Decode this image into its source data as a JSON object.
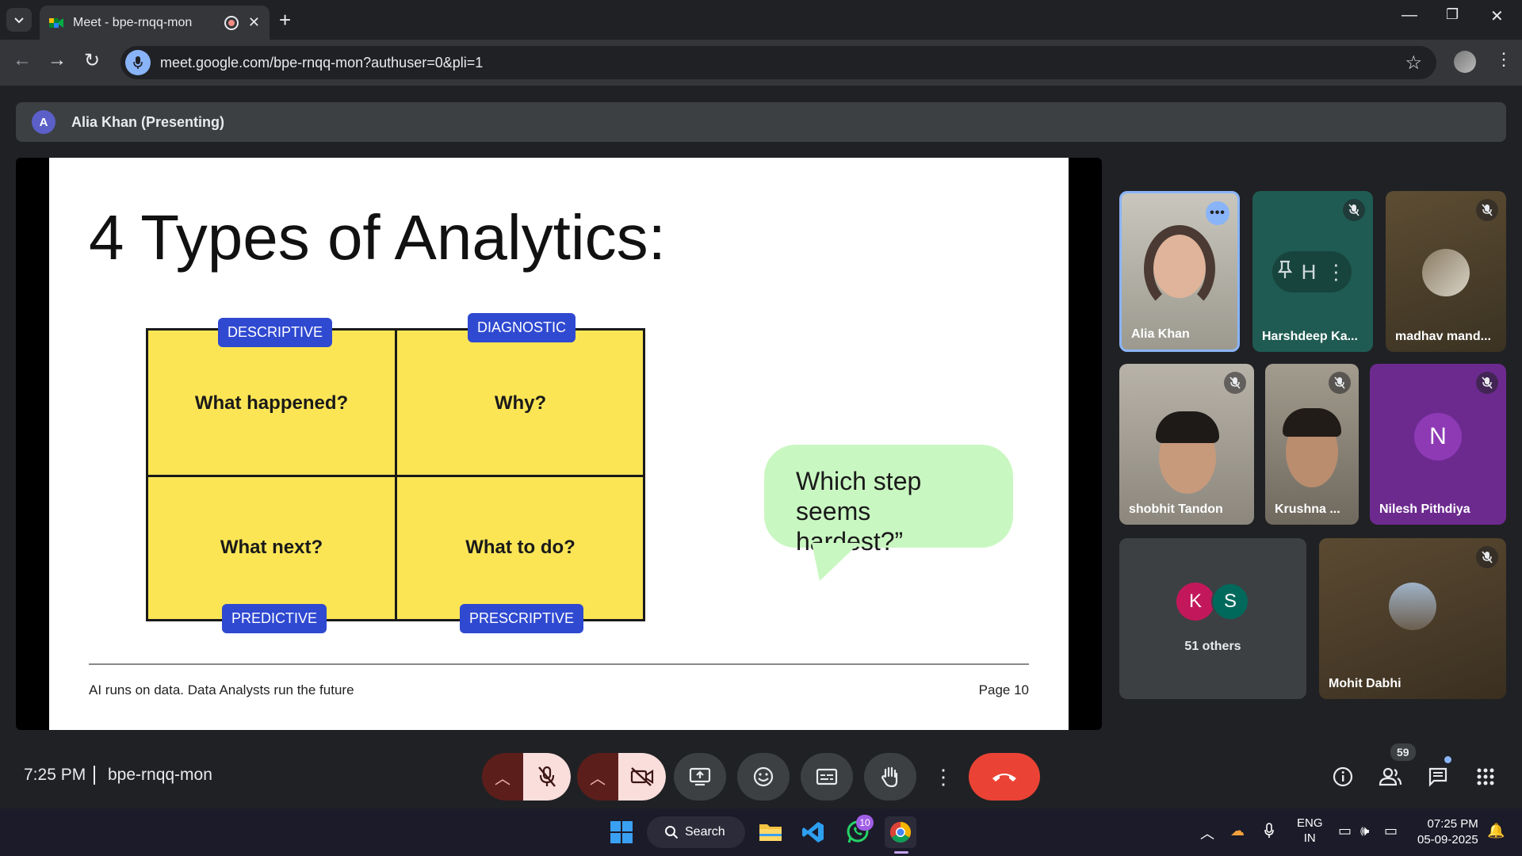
{
  "browser": {
    "tab_title": "Meet - bpe-rnqq-mon",
    "url": "meet.google.com/bpe-rnqq-mon?authuser=0&pli=1"
  },
  "presenting": {
    "avatar_letter": "A",
    "label": "Alia Khan (Presenting)"
  },
  "slide": {
    "title": "4 Types of Analytics:",
    "quadrants": {
      "top_left": {
        "tag": "DESCRIPTIVE",
        "text": "What happened?"
      },
      "top_right": {
        "tag": "DIAGNOSTIC",
        "text": "Why?"
      },
      "bottom_left": {
        "tag": "PREDICTIVE",
        "text": "What next?"
      },
      "bottom_right": {
        "tag": "PRESCRIPTIVE",
        "text": "What to do?"
      }
    },
    "bubble_line1": "Which step",
    "bubble_line2": "seems hardest?”",
    "footer": "AI runs on data. Data Analysts run the future",
    "page": "Page 10"
  },
  "participants": {
    "p1": {
      "name": "Alia Khan"
    },
    "p2": {
      "name": "Harshdeep Ka...",
      "pin_letter": "H"
    },
    "p3": {
      "name": "madhav mand..."
    },
    "p4": {
      "name": "shobhit Tandon"
    },
    "p5": {
      "name": "Krushna ..."
    },
    "p6": {
      "name": "Nilesh Pithdiya",
      "initial": "N"
    },
    "others": {
      "initial1": "K",
      "initial2": "S",
      "label": "51 others"
    },
    "p7": {
      "name": "Mohit Dabhi"
    }
  },
  "controls": {
    "time": "7:25 PM",
    "meeting_code": "bpe-rnqq-mon",
    "people_count": "59"
  },
  "taskbar": {
    "search_label": "Search",
    "whatsapp_badge": "10",
    "lang_line1": "ENG",
    "lang_line2": "IN",
    "clock_time": "07:25 PM",
    "clock_date": "05-09-2025"
  },
  "colors": {
    "accent_blue": "#8ab4f8",
    "end_call_red": "#ea4335",
    "quadrant_yellow": "#fbe555",
    "tag_blue": "#2f49d1",
    "bubble_green": "#c9f7c1"
  }
}
